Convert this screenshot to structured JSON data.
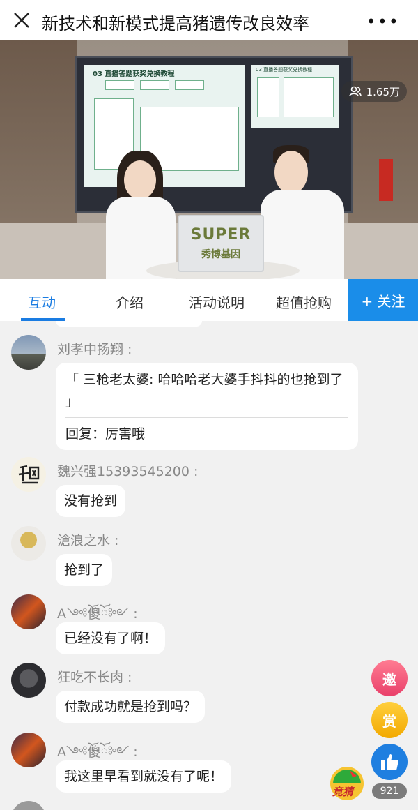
{
  "header": {
    "title": "新技术和新模式提高猪遗传改良效率"
  },
  "video": {
    "viewers": "1.65万",
    "slide_title": "03 直播答题获奖兑换教程",
    "slide2_title": "03 直播答题获奖兑换教程",
    "laptop_brand": "SUPER",
    "laptop_sub": "秀博基因"
  },
  "tabs": {
    "items": [
      "互动",
      "介绍",
      "活动说明",
      "超值抢购"
    ],
    "follow_label": "+ 关注"
  },
  "messages": [
    {
      "name": "刘孝中扬翔 :",
      "quote": "「 三枪老太婆: 哈哈哈老大婆手抖抖的也抢到了 」",
      "reply": "回复：厉害哦"
    },
    {
      "name": "魏兴强15393545200 :",
      "text": "没有抢到"
    },
    {
      "name": "滄浪之水 :",
      "text": "抢到了"
    },
    {
      "name": "A༺ོ傻ོ༻ :",
      "text": "已经没有了啊！"
    },
    {
      "name": "狂吃不长肉 :",
      "text": "付款成功就是抢到吗？"
    },
    {
      "name": "A༺ོ傻ོ༻ :",
      "text": "我这里早看到就没有了呢！"
    }
  ],
  "side_buttons": {
    "invite_label": "邀",
    "reward_label": "赏",
    "like_count": "921",
    "guess_label": "竞猜"
  },
  "colors": {
    "accent": "#1a7ce2",
    "follow_bg": "#1a8de9"
  }
}
